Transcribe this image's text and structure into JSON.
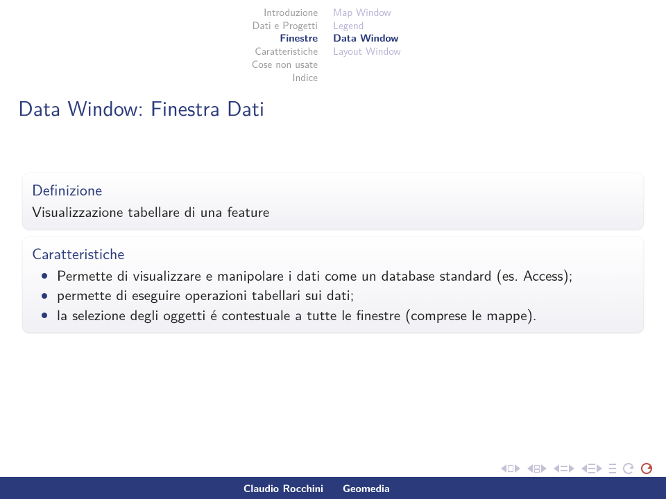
{
  "nav_left": {
    "item0": "Introduzione",
    "item1": "Dati e Progetti",
    "item2": "Finestre",
    "item3": "Caratteristiche",
    "item4": "Cose non usate",
    "item5": "Indice"
  },
  "nav_right": {
    "item0": "Map Window",
    "item1": "Legend",
    "item2": "Data Window",
    "item3": "Layout Window"
  },
  "frame_title": "Data Window: Finestra Dati",
  "block1": {
    "title": "Definizione",
    "body": "Visualizzazione tabellare di una feature"
  },
  "block2": {
    "title": "Caratteristiche",
    "bullet0": "Permette di visualizzare e manipolare i dati come un database standard (es. Access);",
    "bullet1": "permette di eseguire operazioni tabellari sui dati;",
    "bullet2": "la selezione degli oggetti é contestuale a tutte le finestre (comprese le mappe)."
  },
  "footer": {
    "author": "Claudio Rocchini",
    "title": "Geomedia"
  }
}
